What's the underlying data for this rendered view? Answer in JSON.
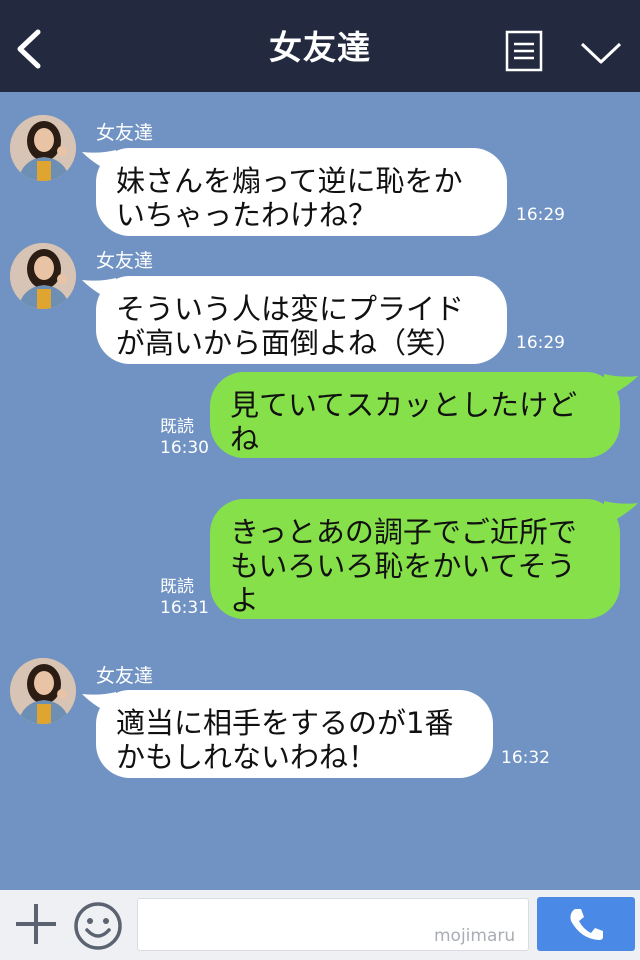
{
  "header": {
    "title": "女友達",
    "back_icon": "chevron-left-icon",
    "menu_icon": "list-icon",
    "dropdown_icon": "chevron-down-icon",
    "background": "#232a40"
  },
  "chat": {
    "background": "#7093c4",
    "messages": [
      {
        "side": "in",
        "sender": "女友達",
        "lines": [
          "妹さんを煽って逆に恥をか",
          "いちゃったわけね？"
        ],
        "time": "16:29"
      },
      {
        "side": "in",
        "sender": "女友達",
        "lines": [
          "そういう人は変にプライド",
          "が高いから面倒よね（笑）"
        ],
        "time": "16:29"
      },
      {
        "side": "out",
        "read": "既読",
        "lines": [
          "見ていてスカッとしたけど",
          "ね"
        ],
        "time": "16:30"
      },
      {
        "side": "out",
        "read": "既読",
        "lines": [
          "きっとあの調子でご近所で",
          "もいろいろ恥をかいてそう",
          "よ"
        ],
        "time": "16:31"
      },
      {
        "side": "in",
        "sender": "女友達",
        "lines": [
          "適当に相手をするのが1番",
          "かもしれないわね！"
        ],
        "time": "16:32"
      }
    ]
  },
  "input_bar": {
    "plus_icon": "plus-icon",
    "emoji_icon": "smiley-icon",
    "call_icon": "phone-icon",
    "watermark": "mojimaru",
    "call_color": "#4a8ae6"
  }
}
